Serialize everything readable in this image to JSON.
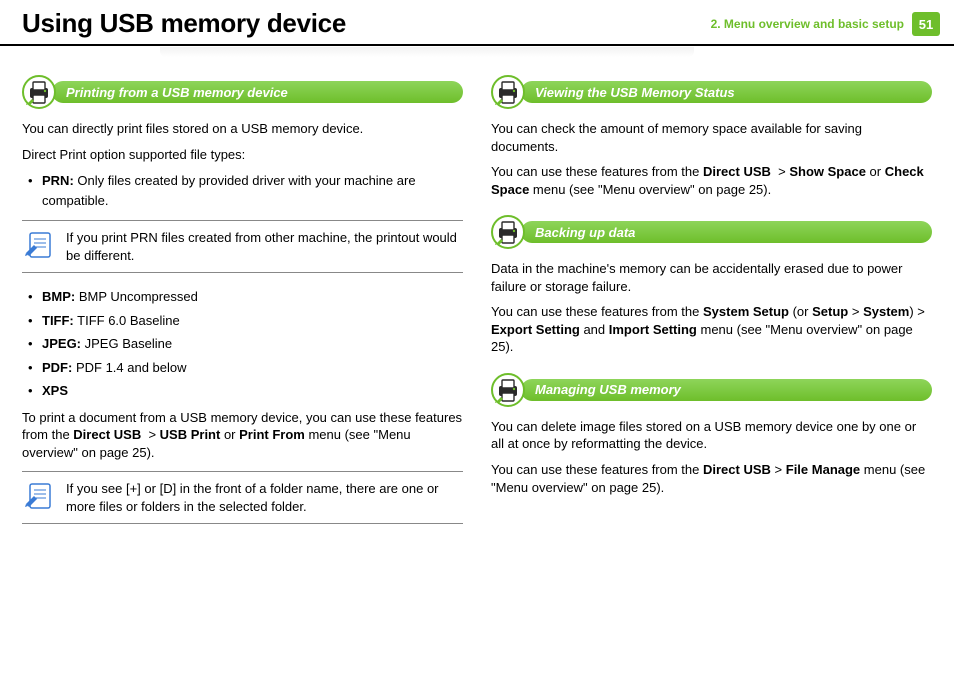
{
  "header": {
    "title": "Using USB memory device",
    "chapter": "2.  Menu overview and basic setup",
    "pageNumber": "51"
  },
  "left": {
    "sec1": {
      "title": "Printing from a USB memory device",
      "p1": "You can directly print files stored on a USB memory device.",
      "p2": "Direct Print option supported file types:",
      "li_prn_b": "PRN:",
      "li_prn_t": " Only files created by provided driver with your machine are compatible.",
      "note1": "If you print PRN files created from other machine, the printout would be different.",
      "li_bmp_b": "BMP:",
      "li_bmp_t": " BMP Uncompressed",
      "li_tif_b": "TIFF:",
      "li_tif_t": " TIFF 6.0 Baseline",
      "li_jpg_b": "JPEG:",
      "li_jpg_t": " JPEG Baseline",
      "li_pdf_b": "PDF:",
      "li_pdf_t": " PDF 1.4 and below",
      "li_xps_b": "XPS",
      "p3a": "To print a document from a USB memory device, you can use these features from the ",
      "p3b": "Direct USB",
      "p3c": "  > ",
      "p3d": "USB Print",
      "p3e": " or ",
      "p3f": "Print From",
      "p3g": " menu (see \"Menu overview\" on page 25).",
      "note2": "If you see [+] or [D] in the front of a folder name, there are one or more files or folders in the selected folder."
    }
  },
  "right": {
    "sec1": {
      "title": "Viewing the USB Memory Status",
      "p1": "You can check the amount of memory space available for saving documents.",
      "p2a": "You can use these features from the ",
      "p2b": "Direct USB",
      "p2c": "  > ",
      "p2d": "Show Space",
      "p2e": " or ",
      "p2f": "Check Space",
      "p2g": " menu (see \"Menu overview\" on page 25)."
    },
    "sec2": {
      "title": "Backing up data",
      "p1": "Data in the machine's memory can be accidentally erased due to power failure or storage failure.",
      "p2a": "You can use these features from the ",
      "p2b": "System Setup",
      "p2c": " (or ",
      "p2d": "Setup",
      "p2e": " > ",
      "p2f": "System",
      "p2g": ") > ",
      "p2h": "Export Setting",
      "p2i": " and ",
      "p2j": "Import Setting",
      "p2k": " menu (see \"Menu overview\" on page 25)."
    },
    "sec3": {
      "title": "Managing USB memory",
      "p1": "You can delete image files stored on a USB memory device one by one or all at once by reformatting the device.",
      "p2a": "You can use these features from the ",
      "p2b": "Direct USB",
      "p2c": " > ",
      "p2d": "File Manage",
      "p2e": " menu (see \"Menu overview\" on page 25)."
    }
  }
}
